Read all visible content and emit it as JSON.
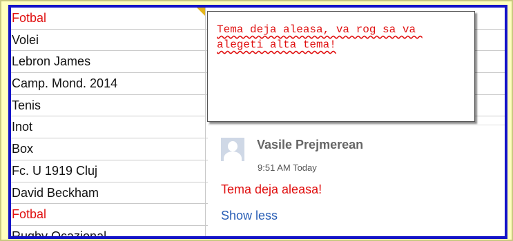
{
  "colors": {
    "background": "#ffffbf",
    "viewport_border": "#1414c8",
    "red_text": "#e01010",
    "link": "#2a5fb6",
    "grid": "#c9c9c9",
    "comment_indicator": "#e3b41a"
  },
  "sheet": {
    "rows": [
      {
        "text": "Fotbal",
        "highlight": true
      },
      {
        "text": "Volei",
        "highlight": false
      },
      {
        "text": "Lebron James",
        "highlight": false
      },
      {
        "text": "Camp. Mond. 2014",
        "highlight": false
      },
      {
        "text": "Tenis",
        "highlight": false
      },
      {
        "text": "Inot",
        "highlight": false
      },
      {
        "text": "Box",
        "highlight": false
      },
      {
        "text": "Fc. U 1919 Cluj",
        "highlight": false
      },
      {
        "text": "David Beckham",
        "highlight": false
      },
      {
        "text": "Fotbal",
        "highlight": true
      },
      {
        "text": "Rugby Ocazional",
        "highlight": false
      }
    ]
  },
  "note": {
    "text": "Tema deja aleasa, va rog sa va alegeti alta tema!"
  },
  "comment": {
    "author": "Vasile Prejmerean",
    "time": "9:51 AM Today",
    "text": "Tema deja aleasa!",
    "toggle_label": "Show less",
    "avatar_icon": "person-avatar-icon"
  }
}
